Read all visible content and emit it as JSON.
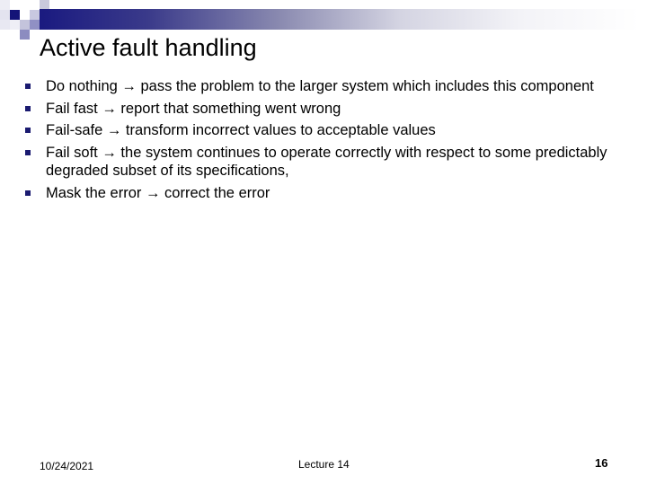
{
  "slide": {
    "title": "Active fault handling",
    "accent_color": "#1a1a80",
    "bullets": [
      {
        "text": "Do nothing → pass the problem to the larger system which includes this component"
      },
      {
        "text": "Fail fast → report that something went wrong"
      },
      {
        "text": "Fail-safe → transform incorrect values to acceptable values"
      },
      {
        "text": "Fail soft → the system continues to operate correctly with respect to some predictably degraded subset of its specifications,"
      },
      {
        "text": "Mask the error → correct the error"
      }
    ]
  },
  "footer": {
    "date": "10/24/2021",
    "center": "Lecture 14",
    "page_number": "16"
  }
}
